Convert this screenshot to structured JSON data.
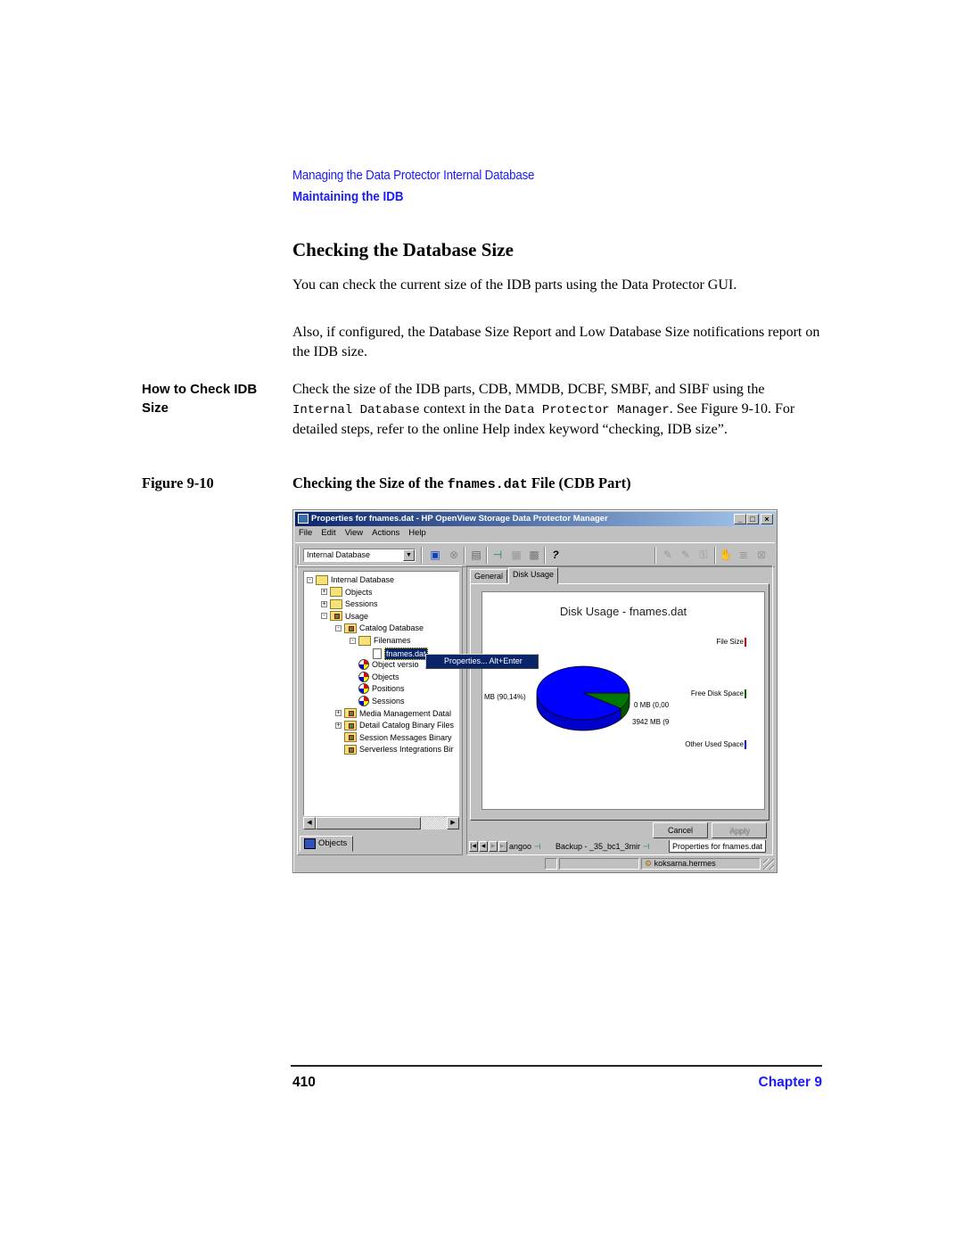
{
  "header": {
    "section": "Managing the Data Protector Internal Database",
    "subsection": "Maintaining the IDB"
  },
  "heading": "Checking the Database Size",
  "paragraphs": {
    "p1": "You can check the current size of the IDB parts using the Data Protector GUI.",
    "p2": "Also, if configured, the Database Size Report and Low Database Size notifications report on the IDB size."
  },
  "how_to": {
    "side_label_line1": "How to Check IDB",
    "side_label_line2": "Size",
    "text_a": "Check the size of the IDB parts, CDB, MMDB, DCBF, SMBF, and SIBF using the ",
    "code_a": "Internal Database",
    "text_b": " context in the ",
    "code_b": "Data Protector Manager",
    "text_c": ". See Figure 9-10. For detailed steps, refer to the online Help index keyword “checking, IDB size”."
  },
  "figure": {
    "label": "Figure 9-10",
    "title_a": "Checking the Size of the ",
    "title_code": "fnames.dat",
    "title_b": " File (CDB Part)"
  },
  "window": {
    "title": "Properties for fnames.dat - HP OpenView Storage Data Protector Manager",
    "title_buttons": [
      "_",
      "□",
      "×"
    ],
    "menu": [
      "File",
      "Edit",
      "View",
      "Actions",
      "Help"
    ],
    "context_combo": "Internal Database",
    "toolbar_icons": [
      "manager-icon",
      "stop-icon",
      "window-icon",
      "pin-icon",
      "grid-icon",
      "calendar-icon",
      "help-icon",
      "wizard1-icon",
      "wizard2-icon",
      "lock-icon",
      "hand-icon",
      "drive-icon",
      "tape-icon"
    ],
    "help_glyph": "?",
    "tree": [
      {
        "label": "Internal Database",
        "level": 0,
        "expander": "-"
      },
      {
        "label": "Objects",
        "level": 1,
        "expander": "+"
      },
      {
        "label": "Sessions",
        "level": 1,
        "expander": "+"
      },
      {
        "label": "Usage",
        "level": 1,
        "expander": "-"
      },
      {
        "label": "Catalog Database",
        "level": 2,
        "expander": "-"
      },
      {
        "label": "Filenames",
        "level": 3,
        "expander": "-"
      },
      {
        "label": "fnames.dat",
        "level": 4,
        "selected": true
      },
      {
        "label": "Object versio",
        "level": 3
      },
      {
        "label": "Objects",
        "level": 3
      },
      {
        "label": "Positions",
        "level": 3
      },
      {
        "label": "Sessions",
        "level": 3
      },
      {
        "label": "Media Management Datal",
        "level": 2,
        "expander": "+"
      },
      {
        "label": "Detail Catalog Binary Files",
        "level": 2,
        "expander": "+"
      },
      {
        "label": "Session Messages Binary",
        "level": 2
      },
      {
        "label": "Serverless Integrations Bir",
        "level": 2
      }
    ],
    "context_menu": "Properties...  Alt+Enter",
    "left_tab": "Objects",
    "tabs": [
      "General",
      "Disk Usage"
    ],
    "active_tab": "Disk Usage",
    "buttons": {
      "cancel": "Cancel",
      "apply": "Apply"
    },
    "workspace_tabs": [
      "angoo",
      "Backup - _35_bc1_3mir",
      "Properties for fnames.dat"
    ],
    "status": {
      "server": "koksarna.hermes"
    }
  },
  "chart_data": {
    "type": "pie",
    "title": "Disk Usage - fnames.dat",
    "legend": [
      {
        "name": "File Size",
        "color": "#cc0000"
      },
      {
        "name": "Free Disk Space",
        "color": "#006600"
      },
      {
        "name": "Other Used Space",
        "color": "#0000ff"
      }
    ],
    "slices": [
      {
        "name": "File Size",
        "label": "0 MB (0,00",
        "percent": 0.0,
        "color": "#cc0000"
      },
      {
        "name": "Free Disk Space",
        "label": "3942 MB (9",
        "percent": 9.86,
        "color": "#007700"
      },
      {
        "name": "Other Used Space",
        "label": "MB (90,14%)",
        "percent": 90.14,
        "color": "#0000ff"
      }
    ],
    "legend_position": "right"
  },
  "footer": {
    "page_number": "410",
    "chapter": "Chapter 9"
  }
}
